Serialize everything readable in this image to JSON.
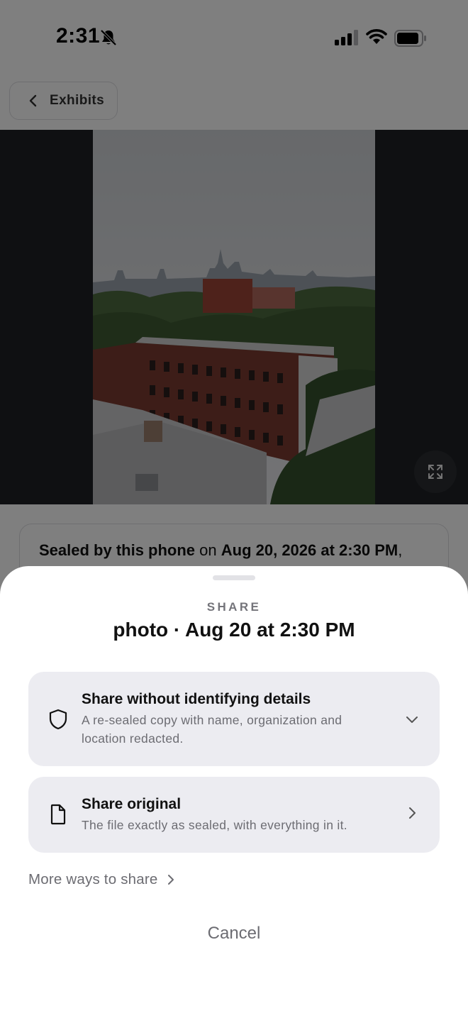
{
  "status_bar": {
    "time": "2:31"
  },
  "nav": {
    "back_label": "Exhibits"
  },
  "seal_card": {
    "prefix_bold": "Sealed by this phone",
    "joiner": " on ",
    "date_bold": "Aug 20, 2026 at 2:30 PM",
    "suffix": ","
  },
  "share_sheet": {
    "eyebrow": "SHARE",
    "title": "photo · Aug 20 at 2:30 PM",
    "options": [
      {
        "title": "Share without identifying details",
        "description": "A re-sealed copy with name, organization and location redacted.",
        "icon": "shield-icon",
        "accessory": "chevron-down-icon"
      },
      {
        "title": "Share original",
        "description": "The file exactly as sealed, with everything in it.",
        "icon": "document-icon",
        "accessory": "chevron-right-icon"
      }
    ],
    "more_ways_label": "More ways to share",
    "cancel_label": "Cancel"
  },
  "colors": {
    "sheet_background": "#ffffff",
    "option_background": "#ececf1",
    "secondary_text": "#6c6c72",
    "overlay": "rgba(0,0,0,0.5)"
  }
}
